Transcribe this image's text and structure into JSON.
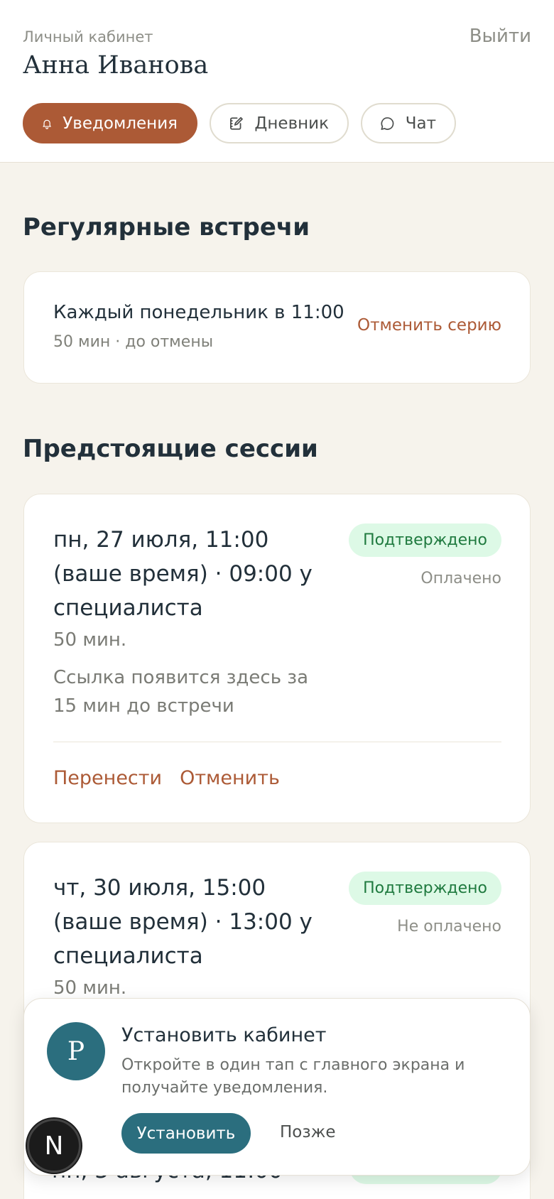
{
  "header": {
    "cabinet_label": "Личный кабинет",
    "user_name": "Анна Иванова",
    "logout": "Выйти",
    "tabs": [
      {
        "label": "Уведомления",
        "icon": "bell-icon",
        "active": true
      },
      {
        "label": "Дневник",
        "icon": "notebook-icon",
        "active": false
      },
      {
        "label": "Чат",
        "icon": "chat-bubble-icon",
        "active": false
      }
    ]
  },
  "recurring": {
    "section_title": "Регулярные встречи",
    "title": "Каждый понедельник в 11:00",
    "subtitle": "50 мин · до отмены",
    "cancel": "Отменить серию"
  },
  "upcoming": {
    "section_title": "Предстоящие сессии",
    "sessions": [
      {
        "title": "пн, 27 июля, 11:00 (ваше время) · 09:00 у специалиста",
        "duration": "50 мин.",
        "note": "Ссылка появится здесь за 15 мин до встречи",
        "status": "Подтверждено",
        "payment": "Оплачено",
        "reschedule": "Перенести",
        "cancel": "Отменить"
      },
      {
        "title": "чт, 30 июля, 15:00 (ваше время) · 13:00 у специалиста",
        "duration": "50 мин.",
        "status": "Подтверждено",
        "payment": "Не оплачено"
      },
      {
        "title": "пн, 3 августа, 11:00",
        "status": "Подтверждено"
      }
    ]
  },
  "install": {
    "avatar_letter": "P",
    "title": "Установить кабинет",
    "description": "Откройте в один тап с главного экрана и получайте уведомления.",
    "install_button": "Установить",
    "later_button": "Позже"
  },
  "dev_badge": {
    "letter": "N"
  },
  "colors": {
    "accent": "#ac5a36",
    "teal": "#2b6e7e",
    "background": "#f6f3ec",
    "badge_bg": "#ddf9e6",
    "badge_text": "#1f7a3f"
  }
}
